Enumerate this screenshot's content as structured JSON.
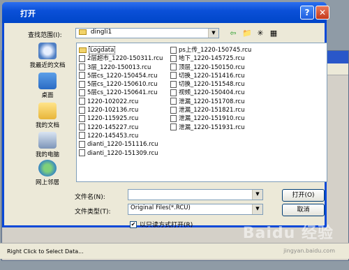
{
  "dialog": {
    "title": "打开",
    "help": "?",
    "close": "✕"
  },
  "lookin": {
    "label": "查找范围(I):",
    "value": "dingli1"
  },
  "places": [
    {
      "label": "我最近的文档",
      "icon": "recent-docs-icon"
    },
    {
      "label": "桌面",
      "icon": "desktop-icon"
    },
    {
      "label": "我的文档",
      "icon": "my-documents-icon"
    },
    {
      "label": "我的电脑",
      "icon": "my-computer-icon"
    },
    {
      "label": "网上邻居",
      "icon": "network-icon"
    }
  ],
  "files_col1": [
    "Logdata",
    "2层超市_1220-150311.rcu",
    "3层_1220-150013.rcu",
    "5层cs_1220-150454.rcu",
    "5层cs_1220-150610.rcu",
    "5层cs_1220-150641.rcu",
    "1220-102022.rcu",
    "1220-102136.rcu",
    "1220-115925.rcu",
    "1220-145227.rcu",
    "1220-145453.rcu",
    "dianti_1220-151116.rcu",
    "dianti_1220-151309.rcu"
  ],
  "files_col2": [
    "ps上传_1220-150745.rcu",
    "地下_1220-145725.rcu",
    "顶层_1220-150150.rcu",
    "切换_1220-151416.rcu",
    "切换_1220-151548.rcu",
    "视频_1220-150404.rcu",
    "泄漏_1220-151708.rcu",
    "泄漏_1220-151821.rcu",
    "泄漏_1220-151910.rcu",
    "泄漏_1220-151931.rcu"
  ],
  "filename": {
    "label": "文件名(N):",
    "value": ""
  },
  "filetype": {
    "label": "文件类型(T):",
    "value": "Original Files(*.RCU)"
  },
  "readonly": {
    "label": "以只读方式打开(R)",
    "checked": "✔"
  },
  "buttons": {
    "open": "打开(O)",
    "cancel": "取消"
  },
  "statusbar": {
    "text": "Right Click to Select Data..."
  },
  "watermark": {
    "brand": "Baidu 经验",
    "url": "jingyan.baidu.com"
  }
}
